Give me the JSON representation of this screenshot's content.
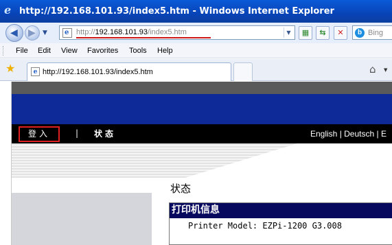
{
  "window": {
    "title": "http://192.168.101.93/index5.htm - Windows Internet Explorer",
    "app_icon": "ie-logo-icon"
  },
  "address_bar": {
    "url_prefix": "http://",
    "url_host": "192.168.101.93",
    "url_path": "/index5.htm",
    "search_placeholder": "Bing"
  },
  "menu": {
    "items": [
      "File",
      "Edit",
      "View",
      "Favorites",
      "Tools",
      "Help"
    ]
  },
  "tabs": [
    {
      "label": "http://192.168.101.93/index5.htm"
    }
  ],
  "page": {
    "nav": {
      "login": "登入",
      "separator": "|",
      "status": "状态",
      "languages": "English | Deutsch | E"
    },
    "title": "状态",
    "info_section": {
      "heading": "打印机信息",
      "rows": [
        "Printer Model: EZPi-1200 G3.008"
      ]
    }
  },
  "colors": {
    "banner_blue": "#0d2a98",
    "nav_black": "#000000",
    "highlight_red": "#e02020",
    "section_header": "#07095e"
  }
}
